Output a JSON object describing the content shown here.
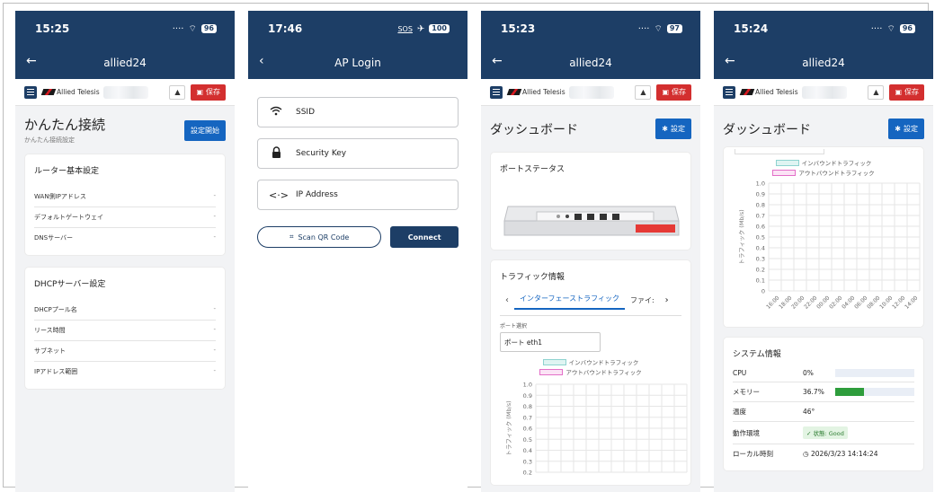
{
  "screens": [
    {
      "status": {
        "time": "15:25",
        "battery": "96"
      },
      "appbar": {
        "title": "allied24"
      },
      "toolbar": {
        "logo_text": "Allied Telesis",
        "save_label": "保存"
      },
      "page": {
        "title": "かんたん接続",
        "subtitle": "かんたん接続設定",
        "action": "設定開始"
      },
      "cards": [
        {
          "title": "ルーター基本設定",
          "rows": [
            {
              "label": "WAN側IPアドレス",
              "value": "-"
            },
            {
              "label": "デフォルトゲートウェイ",
              "value": "-"
            },
            {
              "label": "DNSサーバー",
              "value": "-"
            }
          ]
        },
        {
          "title": "DHCPサーバー設定",
          "rows": [
            {
              "label": "DHCPプール名",
              "value": "-"
            },
            {
              "label": "リース時間",
              "value": "-"
            },
            {
              "label": "サブネット",
              "value": "-"
            },
            {
              "label": "IPアドレス範囲",
              "value": "-"
            }
          ]
        }
      ]
    },
    {
      "status": {
        "time": "17:46",
        "sos": "SOS",
        "battery": "100"
      },
      "appbar": {
        "title": "AP Login"
      },
      "fields": [
        {
          "icon": "wifi-icon",
          "placeholder": "SSID"
        },
        {
          "icon": "lock-icon",
          "placeholder": "Security Key"
        },
        {
          "icon": "arrows-icon",
          "placeholder": "IP Address"
        }
      ],
      "scan_label": "Scan QR Code",
      "connect_label": "Connect"
    },
    {
      "status": {
        "time": "15:23",
        "battery": "97"
      },
      "appbar": {
        "title": "allied24"
      },
      "toolbar": {
        "logo_text": "Allied Telesis",
        "save_label": "保存"
      },
      "page": {
        "title": "ダッシュボード",
        "action": "設定"
      },
      "port_status": {
        "title": "ポートステータス"
      },
      "traffic": {
        "title": "トラフィック情報",
        "tabs": [
          "インターフェーストラフィック",
          "ファイ:"
        ],
        "port_label": "ポート選択",
        "port_value": "ポート eth1",
        "legend": [
          "インバウンドトラフィック",
          "アウトバウンドトラフィック"
        ],
        "ylabel": "トラフィック (Mb/s)",
        "yticks": [
          "1.0",
          "0.9",
          "0.8",
          "0.7",
          "0.6",
          "0.5",
          "0.4",
          "0.3",
          "0.2"
        ]
      }
    },
    {
      "status": {
        "time": "15:24",
        "battery": "96"
      },
      "appbar": {
        "title": "allied24"
      },
      "toolbar": {
        "logo_text": "Allied Telesis",
        "save_label": "保存"
      },
      "page": {
        "title": "ダッシュボード",
        "action": "設定"
      },
      "chart": {
        "legend": [
          "インバウンドトラフィック",
          "アウトバウンドトラフィック"
        ],
        "ylabel": "トラフィック (Mb/s)",
        "yticks": [
          "1.0",
          "0.9",
          "0.8",
          "0.7",
          "0.6",
          "0.5",
          "0.4",
          "0.3",
          "0.2",
          "0.1",
          "0"
        ],
        "xticks": [
          "16:00",
          "18:00",
          "20:00",
          "22:00",
          "00:00",
          "02:00",
          "04:00",
          "06:00",
          "08:00",
          "10:00",
          "12:00",
          "14:00"
        ]
      },
      "system": {
        "title": "システム情報",
        "rows": [
          {
            "label": "CPU",
            "value": "0%",
            "fill": 0.0
          },
          {
            "label": "メモリー",
            "value": "36.7%",
            "fill": 0.367
          },
          {
            "label": "温度",
            "value": "46°"
          },
          {
            "label": "動作環境",
            "value": "状態: Good"
          },
          {
            "label": "ローカル時刻",
            "value": "2026/3/23 14:14:24"
          }
        ]
      }
    }
  ],
  "colors": {
    "navy": "#1d3e66",
    "blue": "#1565c0",
    "red": "#d32f2f",
    "green": "#2e9d3c",
    "inbound": "#8fd3d0",
    "outbound": "#e36fc8"
  }
}
